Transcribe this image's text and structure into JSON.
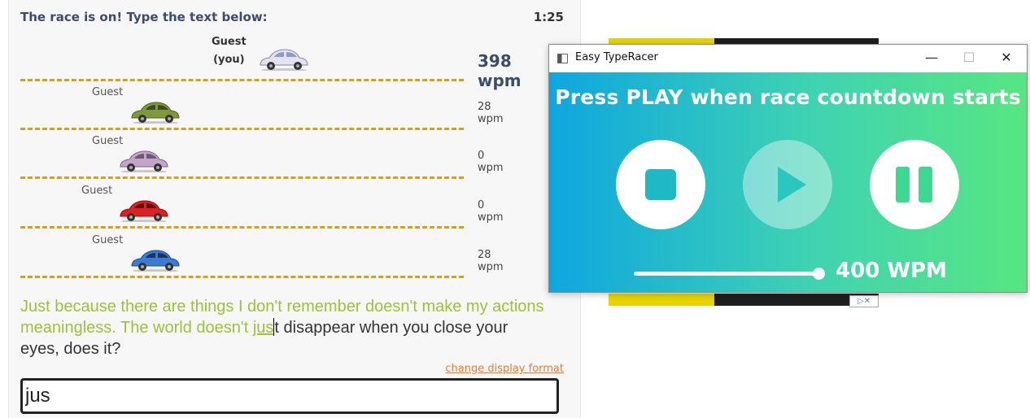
{
  "race": {
    "header": "The race is on! Type the text below:",
    "timer": "1:25",
    "racers": [
      {
        "name": "Guest",
        "you_label": "(you)",
        "wpm": "398 wpm",
        "car_color": "#e4e2ef"
      },
      {
        "name": "Guest",
        "wpm": "28 wpm",
        "car_color": "#7f9a3a"
      },
      {
        "name": "Guest",
        "wpm": "0 wpm",
        "car_color": "#c4a4c8"
      },
      {
        "name": "Guest",
        "wpm": "0 wpm",
        "car_color": "#e02020"
      },
      {
        "name": "Guest",
        "wpm": "28 wpm",
        "car_color": "#3a7bd8"
      }
    ],
    "passage": {
      "typed": "Just because there are things I don't remember doesn't make my actions meaningless. The world doesn't ",
      "current_typed": "jus",
      "remaining": "t disappear when you close your eyes, does it?"
    },
    "change_format_link": "change display format",
    "input_value": "jus"
  },
  "app": {
    "title": "Easy TypeRacer",
    "heading": "Press PLAY when race countdown starts",
    "stop_icon": "stop-icon",
    "play_icon": "play-icon",
    "pause_icon": "pause-icon",
    "speed_fraction": 1.0,
    "speed_label": "400 WPM",
    "gradient_colors": [
      "#0ea6e0",
      "#3fd3b2",
      "#58e681"
    ]
  }
}
